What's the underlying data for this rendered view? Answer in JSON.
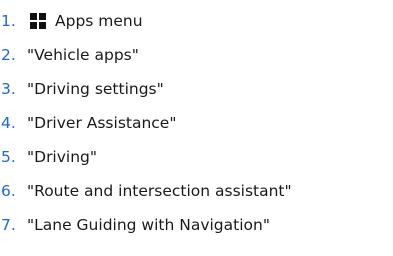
{
  "steps": [
    {
      "number": "1.",
      "icon": "apps-grid-icon",
      "text": "Apps menu"
    },
    {
      "number": "2.",
      "text": "\"Vehicle apps\""
    },
    {
      "number": "3.",
      "text": "\"Driving settings\""
    },
    {
      "number": "4.",
      "text": "\"Driver Assistance\""
    },
    {
      "number": "5.",
      "text": "\"Driving\""
    },
    {
      "number": "6.",
      "text": "\"Route and intersection assistant\""
    },
    {
      "number": "7.",
      "text": "\"Lane Guiding with Navigation\""
    }
  ],
  "colors": {
    "step_number": "#1c69d4",
    "text": "#1a1a1a",
    "icon": "#111111"
  }
}
